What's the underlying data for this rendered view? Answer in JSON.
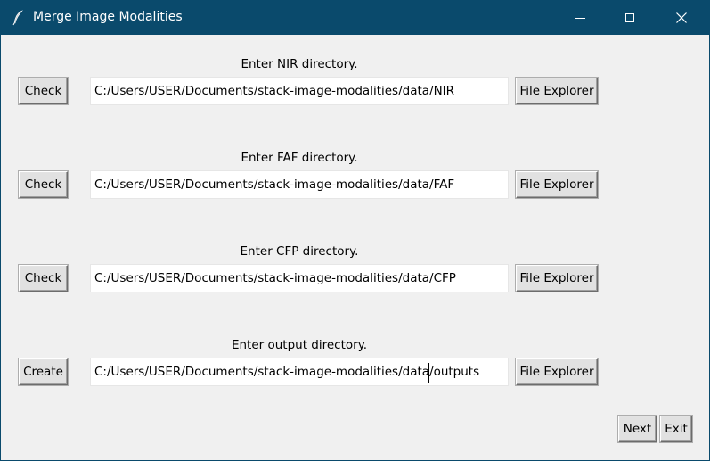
{
  "window": {
    "title": "Merge Image Modalities",
    "icon": "feather-icon"
  },
  "sections": [
    {
      "label": "Enter NIR directory.",
      "action_label": "Check",
      "path": "C:/Users/USER/Documents/stack-image-modalities/data/NIR",
      "browse_label": "File Explorer"
    },
    {
      "label": "Enter FAF directory.",
      "action_label": "Check",
      "path": "C:/Users/USER/Documents/stack-image-modalities/data/FAF",
      "browse_label": "File Explorer"
    },
    {
      "label": "Enter CFP directory.",
      "action_label": "Check",
      "path": "C:/Users/USER/Documents/stack-image-modalities/data/CFP",
      "browse_label": "File Explorer"
    },
    {
      "label": "Enter output directory.",
      "action_label": "Create",
      "path": "C:/Users/USER/Documents/stack-image-modalities/data/outputs",
      "browse_label": "File Explorer"
    }
  ],
  "footer": {
    "next_label": "Next",
    "exit_label": "Exit"
  },
  "colors": {
    "titlebar": "#0a4a6c",
    "window_bg": "#f0f0f0",
    "button_bg": "#e1e1e1"
  }
}
